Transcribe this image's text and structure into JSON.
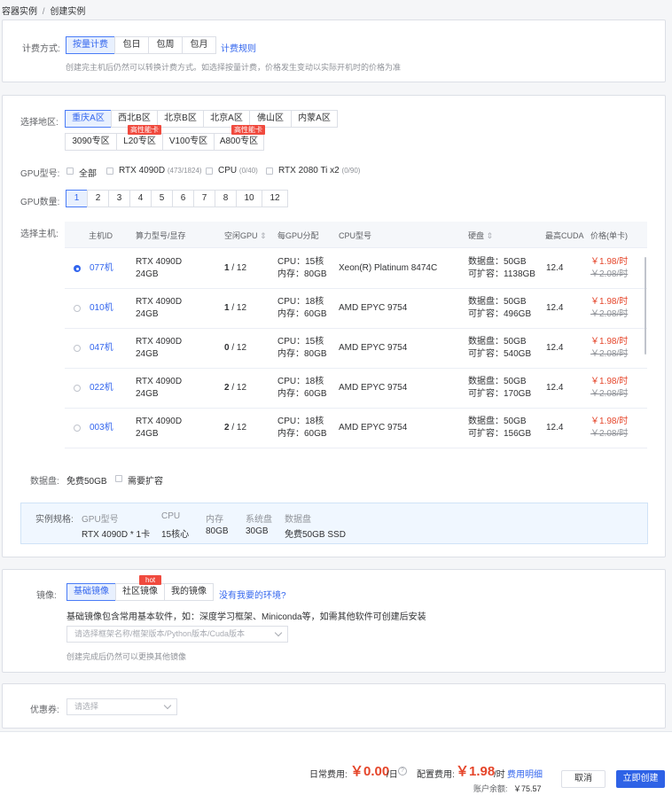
{
  "breadcrumb": {
    "parent": "容器实例",
    "sep": "/",
    "current": "创建实例"
  },
  "billing": {
    "label": "计费方式:",
    "options": [
      "按量计费",
      "包日",
      "包周",
      "包月"
    ],
    "selected": 0,
    "rules_link": "计费规则",
    "hint": "创建完主机后仍然可以转换计费方式。如选择按量计费，价格发生变动以实际开机时的价格为准"
  },
  "region": {
    "label": "选择地区:",
    "row1": [
      "重庆A区",
      "西北B区",
      "北京B区",
      "北京A区",
      "佛山区",
      "内蒙A区"
    ],
    "row2": [
      "3090专区",
      "L20专区",
      "V100专区",
      "A800专区"
    ],
    "selected": 0,
    "badge": "高性能卡"
  },
  "gpu_model": {
    "label": "GPU型号:",
    "options": [
      {
        "name": "全部",
        "count": ""
      },
      {
        "name": "RTX 4090D",
        "count": "(473/1824)"
      },
      {
        "name": "CPU",
        "count": "(0/40)"
      },
      {
        "name": "RTX 2080 Ti x2",
        "count": "(0/90)"
      }
    ]
  },
  "gpu_count": {
    "label": "GPU数量:",
    "options": [
      "1",
      "2",
      "3",
      "4",
      "5",
      "6",
      "7",
      "8",
      "10",
      "12"
    ],
    "selected": 0
  },
  "host": {
    "label": "选择主机:",
    "headers": [
      "主机ID",
      "算力型号/显存",
      "空闲GPU",
      "每GPU分配",
      "CPU型号",
      "硬盘",
      "最高CUDA",
      "价格(单卡)"
    ],
    "rows": [
      {
        "id": "077机",
        "gpu": "RTX 4090D",
        "vram": "24GB",
        "free": "1",
        "total": "/ 12",
        "cpu_alloc": "CPU：15核",
        "mem": "内存：80GB",
        "cpu_model": "Xeon(R) Platinum 8474C",
        "disk": "数据盘：50GB",
        "disk_exp": "可扩容：1138GB",
        "cuda": "12.4",
        "price": "￥1.98/时",
        "old_price": "￥2.08/时",
        "selected": true
      },
      {
        "id": "010机",
        "gpu": "RTX 4090D",
        "vram": "24GB",
        "free": "1",
        "total": "/ 12",
        "cpu_alloc": "CPU：18核",
        "mem": "内存：60GB",
        "cpu_model": "AMD EPYC 9754",
        "disk": "数据盘：50GB",
        "disk_exp": "可扩容：496GB",
        "cuda": "12.4",
        "price": "￥1.98/时",
        "old_price": "￥2.08/时",
        "selected": false
      },
      {
        "id": "047机",
        "gpu": "RTX 4090D",
        "vram": "24GB",
        "free": "0",
        "total": "/ 12",
        "cpu_alloc": "CPU：15核",
        "mem": "内存：80GB",
        "cpu_model": "AMD EPYC 9754",
        "disk": "数据盘：50GB",
        "disk_exp": "可扩容：540GB",
        "cuda": "12.4",
        "price": "￥1.98/时",
        "old_price": "￥2.08/时",
        "selected": false
      },
      {
        "id": "022机",
        "gpu": "RTX 4090D",
        "vram": "24GB",
        "free": "2",
        "total": "/ 12",
        "cpu_alloc": "CPU：18核",
        "mem": "内存：60GB",
        "cpu_model": "AMD EPYC 9754",
        "disk": "数据盘：50GB",
        "disk_exp": "可扩容：170GB",
        "cuda": "12.4",
        "price": "￥1.98/时",
        "old_price": "￥2.08/时",
        "selected": false
      },
      {
        "id": "003机",
        "gpu": "RTX 4090D",
        "vram": "24GB",
        "free": "2",
        "total": "/ 12",
        "cpu_alloc": "CPU：18核",
        "mem": "内存：60GB",
        "cpu_model": "AMD EPYC 9754",
        "disk": "数据盘：50GB",
        "disk_exp": "可扩容：156GB",
        "cuda": "12.4",
        "price": "￥1.98/时",
        "old_price": "￥2.08/时",
        "selected": false
      }
    ]
  },
  "data_disk": {
    "label": "数据盘:",
    "value": "免费50GB",
    "expand": "需要扩容"
  },
  "spec": {
    "label": "实例规格:",
    "headers": [
      "GPU型号",
      "CPU",
      "内存",
      "系统盘",
      "数据盘"
    ],
    "values": [
      "RTX 4090D * 1卡",
      "15核心",
      "80GB",
      "30GB",
      "免费50GB SSD"
    ]
  },
  "image": {
    "label": "镜像:",
    "tabs": [
      "基础镜像",
      "社区镜像",
      "我的镜像"
    ],
    "selected": 0,
    "hot": "hot",
    "missing_link": "没有我要的环境?",
    "desc": "基础镜像包含常用基本软件，如：深度学习框架、Miniconda等，如需其他软件可创建后安装",
    "placeholder": "请选择框架名称/框架版本/Python版本/Cuda版本",
    "hint": "创建完成后仍然可以更换其他镜像"
  },
  "coupon": {
    "label": "优惠券:",
    "placeholder": "请选择"
  },
  "footer": {
    "daily_label": "日常费用:",
    "daily_value": "￥0.00",
    "daily_unit": "/日",
    "config_label": "配置费用:",
    "config_value": "￥1.98",
    "config_unit": "/时",
    "detail_link": "费用明细",
    "balance_label": "账户余额:",
    "balance_value": "￥75.57",
    "cancel": "取消",
    "create": "立即创建"
  },
  "colors": {
    "accent": "#3366ee",
    "price": "#e5452a",
    "badge": "#f04a3e"
  }
}
